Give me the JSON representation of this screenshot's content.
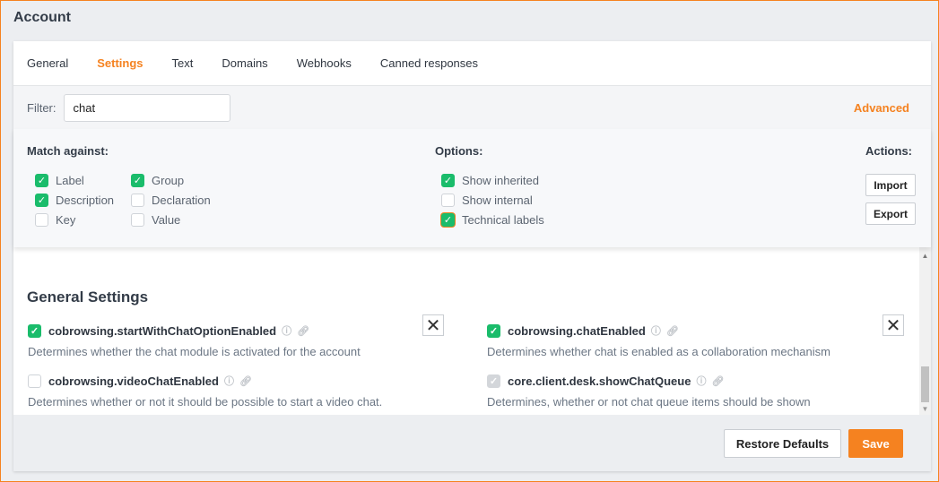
{
  "title": "Account",
  "tabs": [
    "General",
    "Settings",
    "Text",
    "Domains",
    "Webhooks",
    "Canned responses"
  ],
  "active_tab": "Settings",
  "filter": {
    "label": "Filter:",
    "value": "chat",
    "advanced": "Advanced"
  },
  "match": {
    "heading": "Match against:",
    "items": [
      {
        "label": "Label",
        "checked": true
      },
      {
        "label": "Group",
        "checked": true
      },
      {
        "label": "Description",
        "checked": true
      },
      {
        "label": "Declaration",
        "checked": false
      },
      {
        "label": "Key",
        "checked": false
      },
      {
        "label": "Value",
        "checked": false
      }
    ]
  },
  "options": {
    "heading": "Options:",
    "items": [
      {
        "label": "Show inherited",
        "checked": true
      },
      {
        "label": "Show internal",
        "checked": false
      },
      {
        "label": "Technical labels",
        "checked": true
      }
    ]
  },
  "actions": {
    "heading": "Actions:",
    "import": "Import",
    "export": "Export"
  },
  "section": "General Settings",
  "settings": [
    {
      "key": "cobrowsing.startWithChatOptionEnabled",
      "desc": "Determines whether the chat module is activated for the account",
      "state": "checked"
    },
    {
      "key": "cobrowsing.chatEnabled",
      "desc": "Determines whether chat is enabled as a collaboration mechanism",
      "state": "checked"
    },
    {
      "key": "cobrowsing.videoChatEnabled",
      "desc": "Determines whether or not it should be possible to start a video chat.",
      "state": "unchecked"
    },
    {
      "key": "core.client.desk.showChatQueue",
      "desc": "Determines, whether or not chat queue items should be shown",
      "state": "disabled-checked"
    }
  ],
  "footer": {
    "restore": "Restore Defaults",
    "save": "Save"
  },
  "colors": {
    "accent": "#f58220",
    "check": "#1abc6b"
  }
}
